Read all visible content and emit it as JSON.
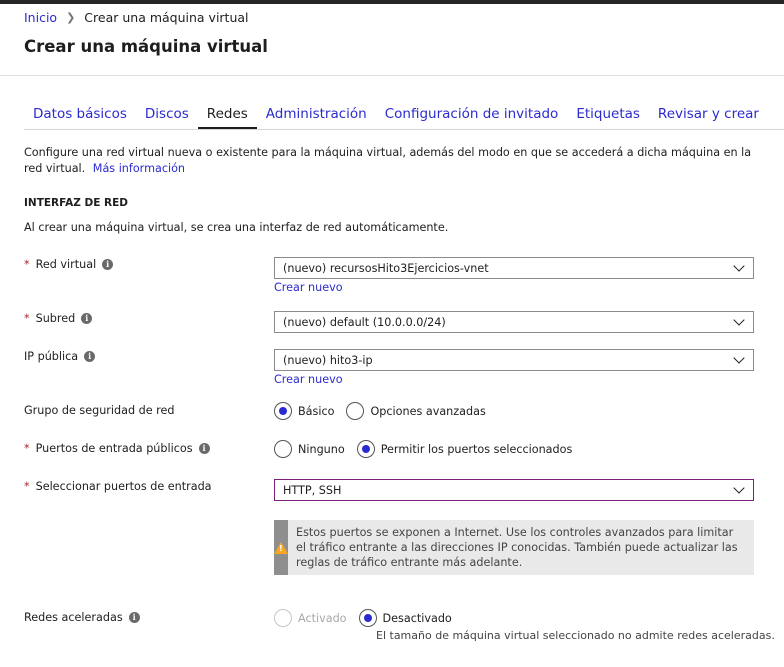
{
  "breadcrumb": {
    "home": "Inicio",
    "current": "Crear una máquina virtual"
  },
  "page_title": "Crear una máquina virtual",
  "tabs": [
    {
      "label": "Datos básicos"
    },
    {
      "label": "Discos"
    },
    {
      "label": "Redes"
    },
    {
      "label": "Administración"
    },
    {
      "label": "Configuración de invitado"
    },
    {
      "label": "Etiquetas"
    },
    {
      "label": "Revisar y crear"
    }
  ],
  "active_tab": "Redes",
  "intro": {
    "text": "Configure una red virtual nueva o existente para la máquina virtual, además del modo en que se accederá a dicha máquina en la red virtual.",
    "link": "Más información"
  },
  "section_title": "INTERFAZ DE RED",
  "auto_text": "Al crear una máquina virtual, se crea una interfaz de red automáticamente.",
  "fields": {
    "vnet": {
      "label": "Red virtual",
      "value": "(nuevo) recursosHito3Ejercicios-vnet",
      "create_link": "Crear nuevo"
    },
    "subnet": {
      "label": "Subred",
      "value": "(nuevo) default (10.0.0.0/24)"
    },
    "public_ip": {
      "label": "IP pública",
      "value": "(nuevo) hito3-ip",
      "create_link": "Crear nuevo"
    },
    "nsg": {
      "label": "Grupo de seguridad de red",
      "options": [
        "Básico",
        "Opciones avanzadas"
      ],
      "selected": "Básico"
    },
    "inbound_ports": {
      "label": "Puertos de entrada públicos",
      "options": [
        "Ninguno",
        "Permitir los puertos seleccionados"
      ],
      "selected": "Permitir los puertos seleccionados"
    },
    "select_ports": {
      "label": "Seleccionar puertos de entrada",
      "value": "HTTP, SSH"
    },
    "accel": {
      "label": "Redes aceleradas",
      "options": [
        "Activado",
        "Desactivado"
      ],
      "selected": "Desactivado",
      "note": "El tamaño de máquina virtual seleccionado no admite redes aceleradas."
    }
  },
  "warning": "Estos puertos se exponen a Internet. Use los controles avanzados para limitar el tráfico entrante a las direcciones IP conocidas. También puede actualizar las reglas de tráfico entrante más adelante.",
  "colors": {
    "link": "#2b2bd0",
    "required": "#a4262c",
    "warning": "#f7a823"
  }
}
